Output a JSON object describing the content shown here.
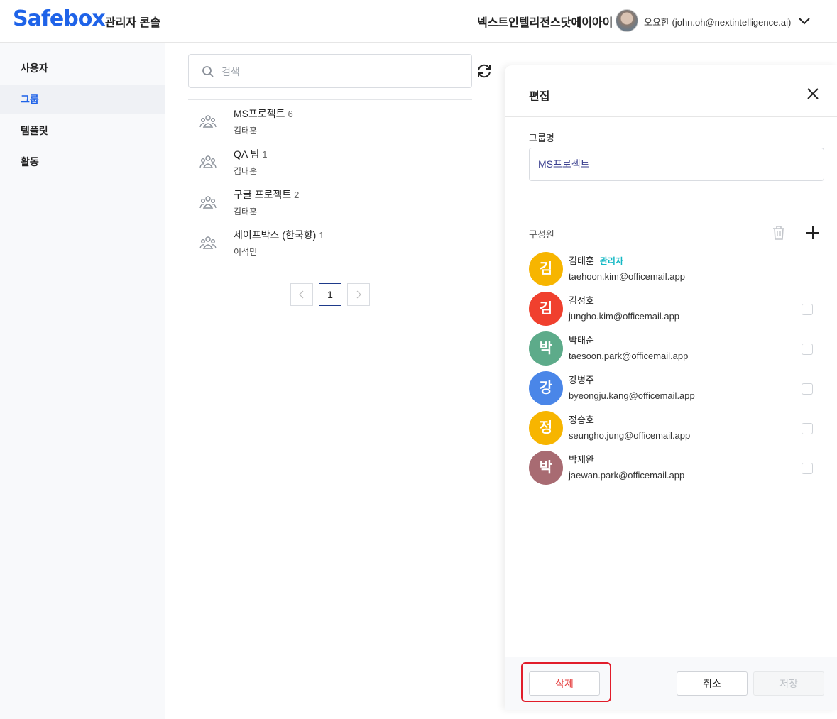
{
  "header": {
    "logo": "Safebox",
    "console_title": "관리자 콘솔",
    "org_name": "넥스트인텔리전스닷에이아이",
    "user_label": "오요한 (john.oh@nextintelligence.ai)"
  },
  "sidebar": {
    "items": [
      {
        "label": "사용자",
        "active": false
      },
      {
        "label": "그룹",
        "active": true
      },
      {
        "label": "템플릿",
        "active": false
      },
      {
        "label": "활동",
        "active": false
      }
    ]
  },
  "search": {
    "placeholder": "검색",
    "value": ""
  },
  "groups": [
    {
      "name": "MS프로젝트",
      "count": "6",
      "owner": "김태훈"
    },
    {
      "name": "QA 팀",
      "count": "1",
      "owner": "김태훈"
    },
    {
      "name": "구글 프로젝트",
      "count": "2",
      "owner": "김태훈"
    },
    {
      "name": "세이프박스 (한국향)",
      "count": "1",
      "owner": "이석민"
    }
  ],
  "pagination": {
    "current": "1"
  },
  "edit_panel": {
    "title": "편집",
    "group_name_label": "그룹명",
    "group_name_value": "MS프로젝트",
    "members_label": "구성원",
    "members": [
      {
        "initial": "김",
        "name": "김태훈",
        "badge": "관리자",
        "email": "taehoon.kim@officemail.app",
        "color": "#f7b500"
      },
      {
        "initial": "김",
        "name": "김정호",
        "badge": "",
        "email": "jungho.kim@officemail.app",
        "color": "#f0402e"
      },
      {
        "initial": "박",
        "name": "박태순",
        "badge": "",
        "email": "taesoon.park@officemail.app",
        "color": "#5dab8a"
      },
      {
        "initial": "강",
        "name": "강병주",
        "badge": "",
        "email": "byeongju.kang@officemail.app",
        "color": "#4a86e8"
      },
      {
        "initial": "정",
        "name": "정승호",
        "badge": "",
        "email": "seungho.jung@officemail.app",
        "color": "#f7b500"
      },
      {
        "initial": "박",
        "name": "박재완",
        "badge": "",
        "email": "jaewan.park@officemail.app",
        "color": "#a86b72"
      }
    ],
    "delete_label": "삭제",
    "cancel_label": "취소",
    "save_label": "저장",
    "highlight_color": "#e11d2b"
  }
}
